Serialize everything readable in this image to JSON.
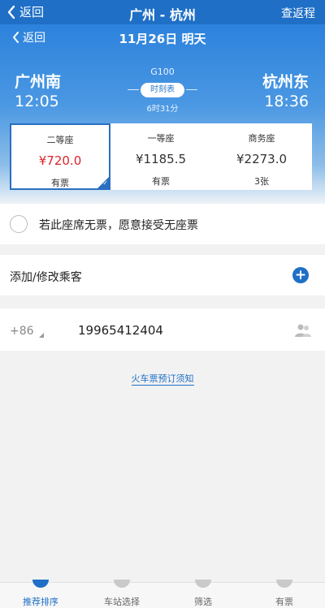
{
  "header": {
    "back_label": "返回",
    "title": "广州 - 杭州",
    "right_label": "查返程"
  },
  "subheader": {
    "back_label": "返回",
    "date": "11月26日 明天"
  },
  "trip": {
    "from_station": "广州南",
    "from_time": "12:05",
    "to_station": "杭州东",
    "to_time": "18:36",
    "train_no": "G100",
    "timetable_label": "时刻表",
    "duration": "6时31分"
  },
  "seats": [
    {
      "name": "二等座",
      "price": "¥720.0",
      "availability": "有票",
      "selected": true
    },
    {
      "name": "一等座",
      "price": "¥1185.5",
      "availability": "有票",
      "selected": false
    },
    {
      "name": "商务座",
      "price": "¥2273.0",
      "availability": "3张",
      "selected": false
    }
  ],
  "options": {
    "no_seat_text": "若此座席无票，愿意接受无座票"
  },
  "passengers": {
    "add_label": "添加/修改乘客"
  },
  "contact": {
    "country_code": "+86",
    "phone": "19965412404"
  },
  "notice": {
    "link_text": "火车票预订须知"
  },
  "bottom_nav": [
    {
      "label": "推荐排序",
      "active": true
    },
    {
      "label": "车站选择",
      "active": false
    },
    {
      "label": "筛选",
      "active": false
    },
    {
      "label": "有票",
      "active": false
    }
  ],
  "colors": {
    "primary": "#1f6fc6",
    "price_selected": "#d9262c"
  }
}
